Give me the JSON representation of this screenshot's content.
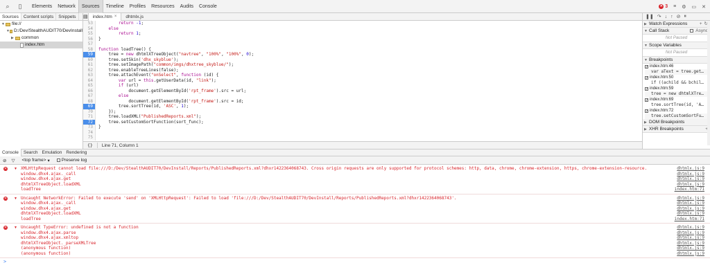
{
  "toptabs": [
    "Elements",
    "Network",
    "Sources",
    "Timeline",
    "Profiles",
    "Resources",
    "Audits",
    "Console"
  ],
  "active_toptab": "Sources",
  "error_count": "3",
  "navigator": {
    "tabs": [
      "Sources",
      "Content scripts",
      "Snippets"
    ],
    "tree": [
      {
        "label": "file://",
        "type": "root"
      },
      {
        "label": "D:/Dev/StealthAUDIT70/DevInstall",
        "type": "folder"
      },
      {
        "label": "common",
        "type": "folder"
      },
      {
        "label": "index.htm",
        "type": "file"
      }
    ]
  },
  "editor": {
    "tabs": [
      "index.htm",
      "dhtmlx.js"
    ],
    "status_braces": "{}",
    "status_pos": "Line 71, Column 1",
    "lines": [
      {
        "n": "53",
        "code": "        return -1;",
        "bp": false
      },
      {
        "n": "54",
        "code": "    else",
        "bp": false
      },
      {
        "n": "55",
        "code": "        return 1;",
        "bp": false
      },
      {
        "n": "56",
        "code": "}",
        "bp": false
      },
      {
        "n": "57",
        "code": "",
        "bp": false
      },
      {
        "n": "58",
        "code": "function loadTree() {",
        "bp": false
      },
      {
        "n": "59",
        "code": "    tree = new dhtmlXTreeObject(\"navtree\", \"100%\", \"100%\", 0);",
        "bp": true
      },
      {
        "n": "60",
        "code": "    tree.setSkin('dhx_skyblue');",
        "bp": false
      },
      {
        "n": "61",
        "code": "    tree.setImagePath(\"common/imgs/dhxtree_skyblue/\");",
        "bp": false
      },
      {
        "n": "62",
        "code": "    tree.enableTreeLines(false);",
        "bp": false
      },
      {
        "n": "63",
        "code": "    tree.attachEvent(\"onSelect\", function (id) {",
        "bp": false
      },
      {
        "n": "64",
        "code": "        var url = this.getUserData(id, \"link\");",
        "bp": false
      },
      {
        "n": "65",
        "code": "        if (url)",
        "bp": false
      },
      {
        "n": "66",
        "code": "            document.getElementById('rpt_frame').src = url;",
        "bp": false
      },
      {
        "n": "67",
        "code": "        else",
        "bp": false
      },
      {
        "n": "68",
        "code": "            document.getElementById('rpt_frame').src = id;",
        "bp": false
      },
      {
        "n": "69",
        "code": "        tree.sortTree(id, 'ASC', 1);",
        "bp": true
      },
      {
        "n": "70",
        "code": "    });",
        "bp": false
      },
      {
        "n": "71",
        "code": "    tree.loadXML(\"PublishedReports.xml\");",
        "bp": false
      },
      {
        "n": "72",
        "code": "    tree.setCustomSortFunction(sort_func);",
        "bp": true
      },
      {
        "n": "73",
        "code": "}",
        "bp": false
      },
      {
        "n": "74",
        "code": "",
        "bp": false
      },
      {
        "n": "75",
        "code": "",
        "bp": false
      }
    ]
  },
  "sidebar": {
    "watch": "Watch Expressions",
    "callstack": "Call Stack",
    "async": "Async",
    "not_paused": "Not Paused",
    "scope": "Scope Variables",
    "breakpoints_title": "Breakpoints",
    "breakpoints": [
      {
        "file": "index.htm:46",
        "code": "var aText = tree.get…"
      },
      {
        "file": "index.htm:50",
        "code": "if ((achild && bchil…"
      },
      {
        "file": "index.htm:59",
        "code": "tree = new dhtmlXTre…"
      },
      {
        "file": "index.htm:69",
        "code": "tree.sortTree(id, 'A…"
      },
      {
        "file": "index.htm:72",
        "code": "tree.setCustomSortFu…"
      }
    ],
    "dom_bp": "DOM Breakpoints",
    "xhr_bp": "XHR Breakpoints"
  },
  "drawer_tabs": [
    "Console",
    "Search",
    "Emulation",
    "Rendering"
  ],
  "console_toolbar": {
    "frame": "<top frame>",
    "preserve_log": "Preserve log"
  },
  "console_messages": [
    {
      "lines": [
        {
          "text": "XMLHttpRequest cannot load file:///D:/Dev/StealthAUDIT70/DevInstall/Reports/PublishedReports.xml?dhxr1422364068743. Cross origin requests are only supported for protocol schemes: http, data, chrome, chrome-extension, https, chrome-extension-resource.",
          "link": "dhtmlx.js:9"
        },
        {
          "text": "window.dhx4.ajax._call",
          "link": "dhtmlx.js:9"
        },
        {
          "text": "window.dhx4.ajax.get",
          "link": "dhtmlx.js:9"
        },
        {
          "text": "dhtmlXTreeObject.loadXML",
          "link": "dhtmlx.js:9"
        },
        {
          "text": "loadTree",
          "link": "index.htm:71"
        }
      ]
    },
    {
      "lines": [
        {
          "text": "Uncaught NetworkError: Failed to execute 'send' on 'XMLHttpRequest': Failed to load 'file:///D:/Dev/StealthAUDIT70/DevInstall/Reports/PublishedReports.xml?dhxr1422364068743'.",
          "link": "dhtmlx.js:9"
        },
        {
          "text": "window.dhx4.ajax._call",
          "link": "dhtmlx.js:9"
        },
        {
          "text": "window.dhx4.ajax.get",
          "link": "dhtmlx.js:9"
        },
        {
          "text": "dhtmlXTreeObject.loadXML",
          "link": "dhtmlx.js:9"
        },
        {
          "text": "loadTree",
          "link": "index.htm:71"
        }
      ]
    },
    {
      "lines": [
        {
          "text": "Uncaught TypeError: undefined is not a function",
          "link": "dhtmlx.js:9"
        },
        {
          "text": "window.dhx4.ajax.parse",
          "link": "dhtmlx.js:9"
        },
        {
          "text": "window.dhx4.ajax.xmltop",
          "link": "dhtmlx.js:9"
        },
        {
          "text": "dhtmlXTreeObject._parseXMLTree",
          "link": "dhtmlx.js:9"
        },
        {
          "text": "(anonymous function)",
          "link": "dhtmlx.js:9"
        },
        {
          "text": "(anonymous function)",
          "link": "dhtmlx.js:9"
        }
      ]
    }
  ],
  "prompt": ">"
}
